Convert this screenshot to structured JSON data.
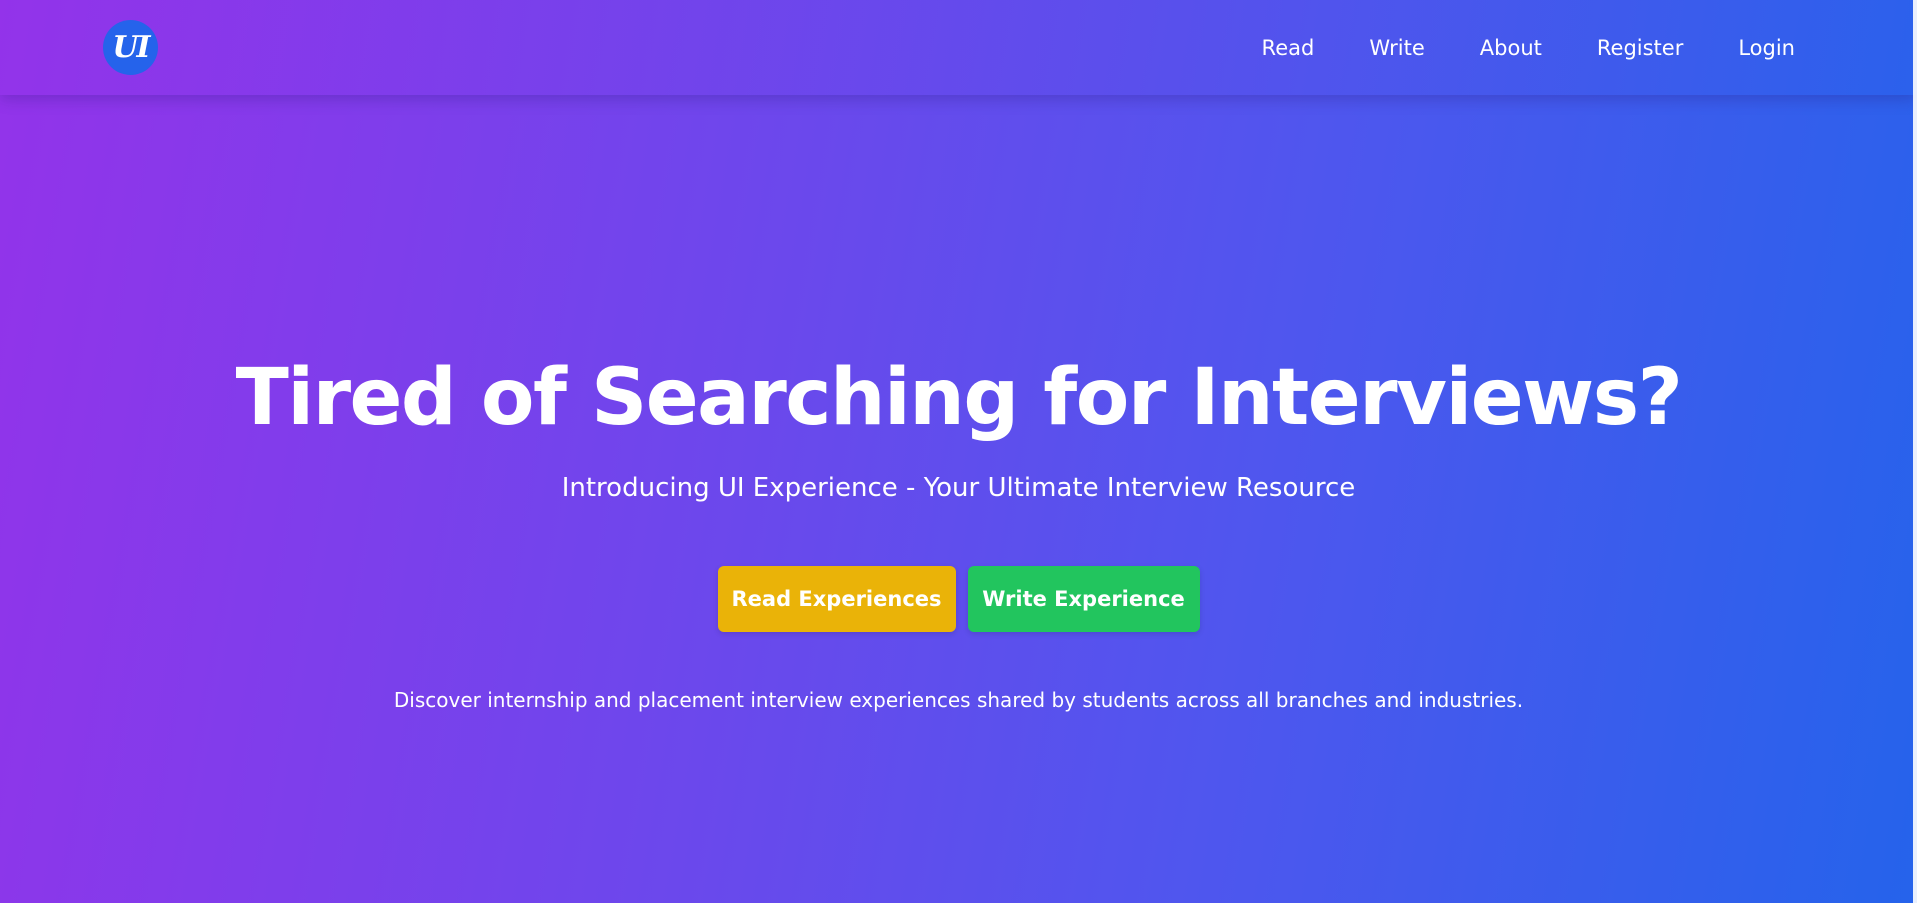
{
  "navbar": {
    "logo_text": "UI",
    "links": [
      "Read",
      "Write",
      "About",
      "Register",
      "Login"
    ]
  },
  "hero": {
    "title": "Tired of Searching for Interviews?",
    "subtitle": "Introducing UI Experience - Your Ultimate Interview Resource",
    "buttons": {
      "read_label": "Read Experiences",
      "write_label": "Write Experience"
    },
    "description": "Discover internship and placement interview experiences shared by students across all branches and industries."
  },
  "colors": {
    "gradient_start": "#9333ea",
    "gradient_end": "#2563eb",
    "logo_bg": "#2563eb",
    "read_button": "#eab308",
    "write_button": "#22c55e"
  }
}
